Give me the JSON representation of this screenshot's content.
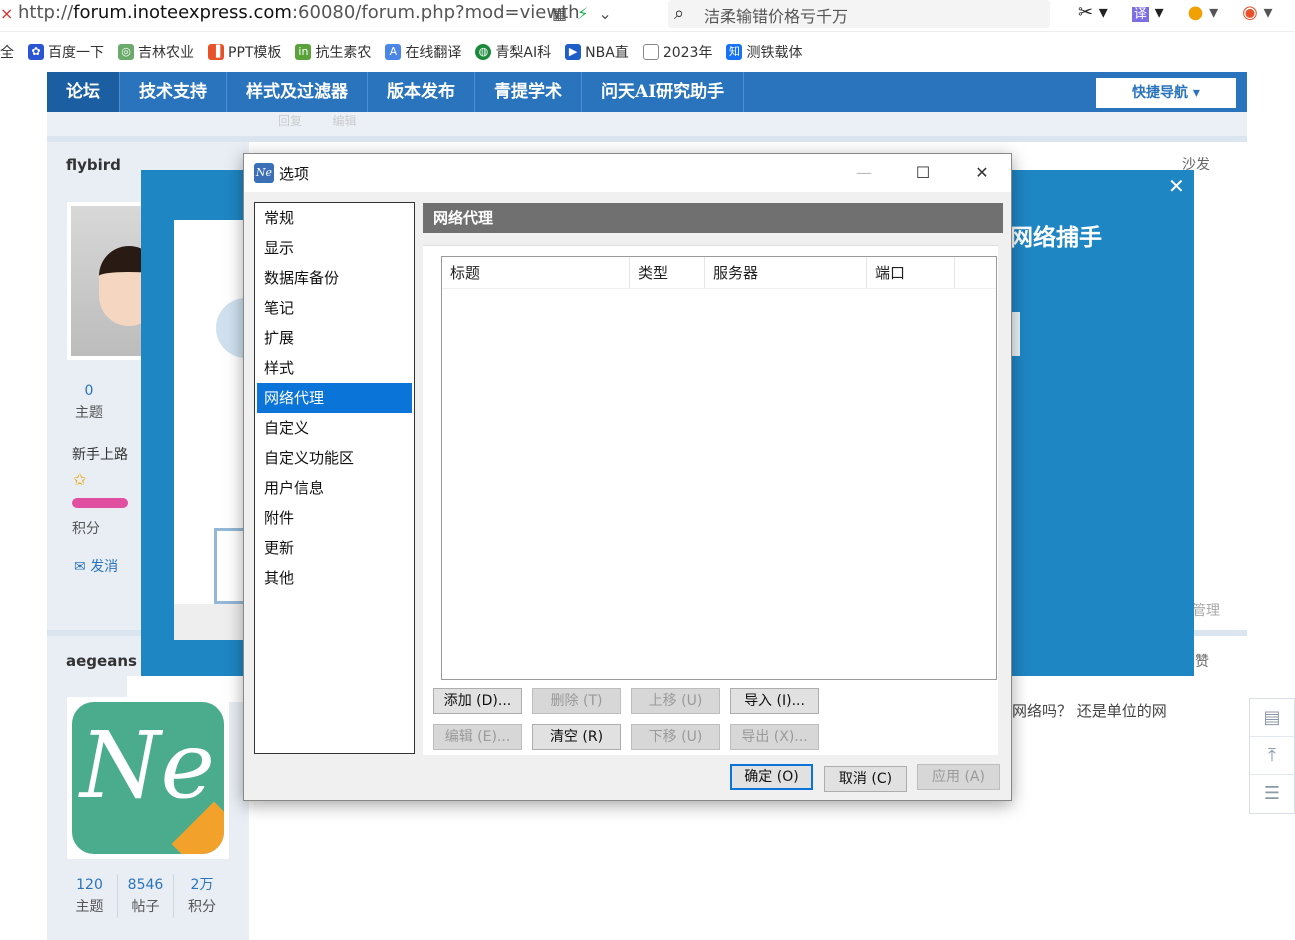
{
  "browser": {
    "url_prefix": "http://",
    "url_host": "forum.inoteexpress.com",
    "url_rest": ":60080/forum.php?mod=viewth",
    "search_text": "洁柔输错价格亏千万",
    "translate_label": "译",
    "bookmarks": [
      "全",
      "百度一下",
      "吉林农业",
      "PPT模板",
      "抗生素农",
      "在线翻译",
      "青梨AI科",
      "NBA直",
      "2023年",
      "测铁载体"
    ]
  },
  "forum": {
    "nav": [
      "论坛",
      "技术支持",
      "样式及过滤器",
      "版本发布",
      "青提学术",
      "问天AI研究助手"
    ],
    "quick_nav": "快捷导航",
    "post1": {
      "author": "flybird",
      "floor": "沙发",
      "topics_count": "0",
      "topics_label": "主题",
      "rank": "新手上路",
      "points_label": "积分",
      "msg": "发消",
      "manage": "管理"
    },
    "post2": {
      "author": "aegeans",
      "zan": "赞",
      "reply_fragment": "网络吗？ 还是单位的网",
      "stats": [
        {
          "num": "120",
          "label": "主题"
        },
        {
          "num": "8546",
          "label": "帖子"
        },
        {
          "num": "2万",
          "label": "积分"
        }
      ]
    },
    "partial_text": {
      "a": "回复",
      "b": "编辑"
    }
  },
  "banner": {
    "title": "网络捕手"
  },
  "dialog": {
    "title": "选项",
    "categories": [
      "常规",
      "显示",
      "数据库备份",
      "笔记",
      "扩展",
      "样式",
      "网络代理",
      "自定义",
      "自定义功能区",
      "用户信息",
      "附件",
      "更新",
      "其他"
    ],
    "selected_index": 6,
    "panel_title": "网络代理",
    "columns": [
      "标题",
      "类型",
      "服务器",
      "端口"
    ],
    "buttons": {
      "add": "添加 (D)...",
      "delete": "删除 (T)",
      "move_up": "上移 (U)",
      "import": "导入 (I)...",
      "edit": "编辑 (E)...",
      "clear": "清空 (R)",
      "move_down": "下移 (U)",
      "export": "导出 (X)...",
      "ok": "确定 (O)",
      "cancel": "取消 (C)",
      "apply": "应用 (A)"
    }
  }
}
